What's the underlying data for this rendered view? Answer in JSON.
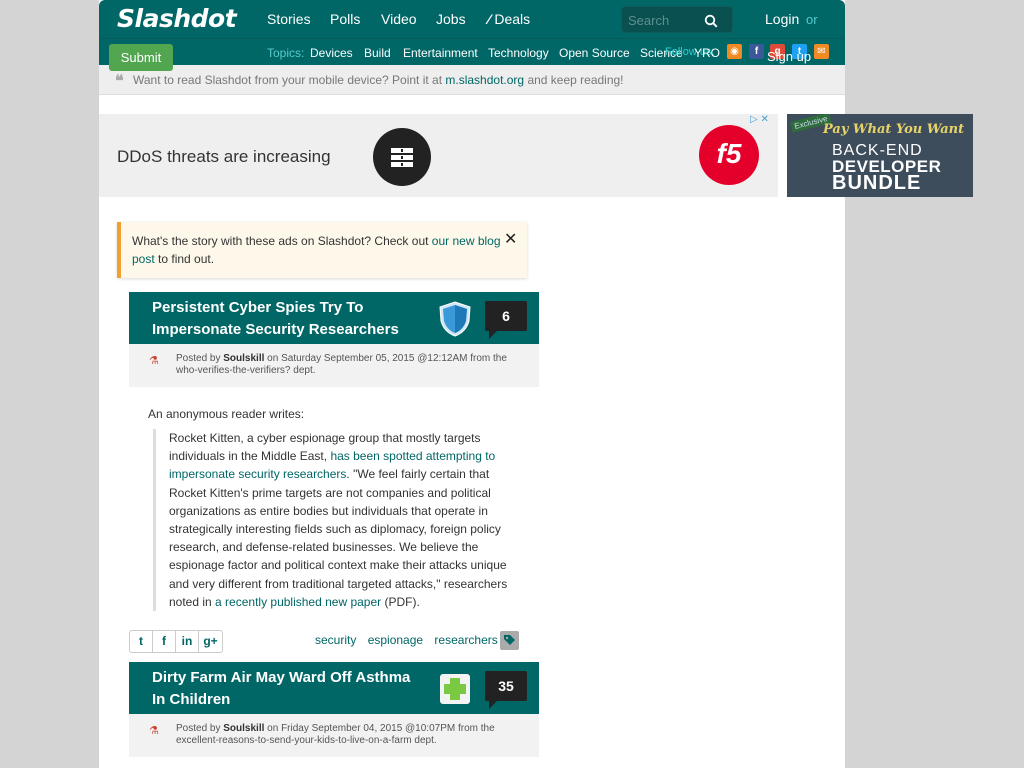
{
  "header": {
    "logo": "Slashdot",
    "nav": [
      "Stories",
      "Polls",
      "Video",
      "Jobs",
      "Deals"
    ],
    "search_placeholder": "Search",
    "login": "Login",
    "or": "or",
    "signup": "Sign up",
    "submit": "Submit"
  },
  "topics": {
    "label": "Topics:",
    "items": [
      "Devices",
      "Build",
      "Entertainment",
      "Technology",
      "Open Source",
      "Science",
      "YRO"
    ],
    "follow": "Follow us:"
  },
  "mobile": {
    "text_before": "Want to read Slashdot from your mobile device? Point it at",
    "link": "m.slashdot.org",
    "text_after": "and keep reading!"
  },
  "ad": {
    "text": "DDoS threats are increasing",
    "brand": "f5",
    "bundle_tag": "Exclusive",
    "bundle_pay": "Pay What You Want",
    "bundle_line1": "BACK-END",
    "bundle_line2": "DEVELOPER",
    "bundle_line3": "BUNDLE"
  },
  "notice": {
    "text_before": "What's the story with these ads on Slashdot? Check out",
    "link": "our new blog post",
    "text_after": "to find out."
  },
  "stories": [
    {
      "title": "Persistent Cyber Spies Try To Impersonate Security Researchers",
      "comments": "6",
      "posted_by_label": "Posted by",
      "author": "Soulskill",
      "meta": "on Saturday September 05, 2015 @12:12AM from the who-verifies-the-verifiers? dept."
    },
    {
      "title": "Dirty Farm Air May Ward Off Asthma In Children",
      "comments": "35",
      "posted_by_label": "Posted by",
      "author": "Soulskill",
      "meta": "on Friday September 04, 2015 @10:07PM from the excellent-reasons-to-send-your-kids-to-live-on-a-farm dept."
    }
  ],
  "body": {
    "intro": "An anonymous reader writes:",
    "q1": "Rocket Kitten, a cyber espionage group that mostly targets individuals in the Middle East,",
    "link1": "has been spotted attempting to impersonate security researchers",
    "q2": ". \"We feel fairly certain that Rocket Kitten's prime targets are not companies and political organizations as entire bodies but individuals that operate in strategically interesting fields such as diplomacy, foreign policy research, and defense-related businesses. We believe the espionage factor and political context make their attacks unique and very different from traditional targeted attacks,\" researchers noted in",
    "link2": "a recently published new paper",
    "q3": "(PDF)."
  },
  "share": [
    "t",
    "f",
    "in",
    "g+"
  ],
  "tags": [
    "security",
    "espionage",
    "researchers"
  ],
  "colors": {
    "brand": "#006666",
    "submit": "#52a650",
    "notice_border": "#f0a030"
  }
}
